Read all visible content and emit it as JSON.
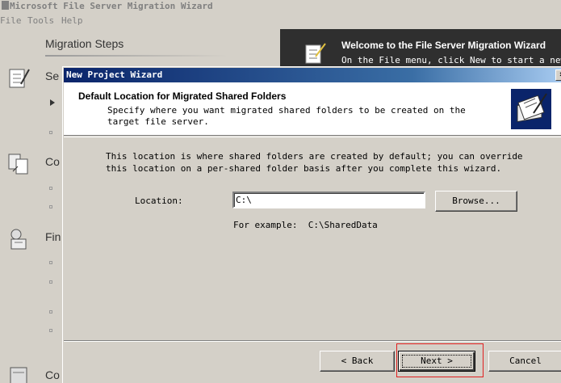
{
  "app": {
    "title": "Microsoft File Server Migration Wizard",
    "menu": {
      "file": "File",
      "tools": "Tools",
      "help": "Help"
    }
  },
  "steps": {
    "header": "Migration Steps",
    "items": [
      {
        "label": "Se",
        "icon": "checklist-icon"
      },
      {
        "label": "Co",
        "icon": "copy-files-icon"
      },
      {
        "label": "Fin",
        "icon": "finalize-icon"
      },
      {
        "label": "Co",
        "icon": "server-icon"
      }
    ]
  },
  "welcome": {
    "title": "Welcome to the File Server Migration Wizard",
    "text": "On the File menu, click New to start a new mi"
  },
  "dialog": {
    "title": "New Project Wizard",
    "close_label": "×",
    "heading": "Default Location for Migrated Shared Folders",
    "subtext": "Specify where you want migrated shared folders to be created on the target file server.",
    "body": "This location is where shared folders are created by default; you can override this location on a per-shared folder basis after you complete this wizard.",
    "location_label": "Location:",
    "location_value": "C:\\",
    "browse_label": "Browse...",
    "example": "For example:  C:\\SharedData",
    "back_label": "Back",
    "next_label": "Next",
    "cancel_label": "Cancel"
  },
  "colors": {
    "titlebar_start": "#0a246a",
    "highlight": "#e02020",
    "welcome_bg": "#2f2f2f"
  }
}
